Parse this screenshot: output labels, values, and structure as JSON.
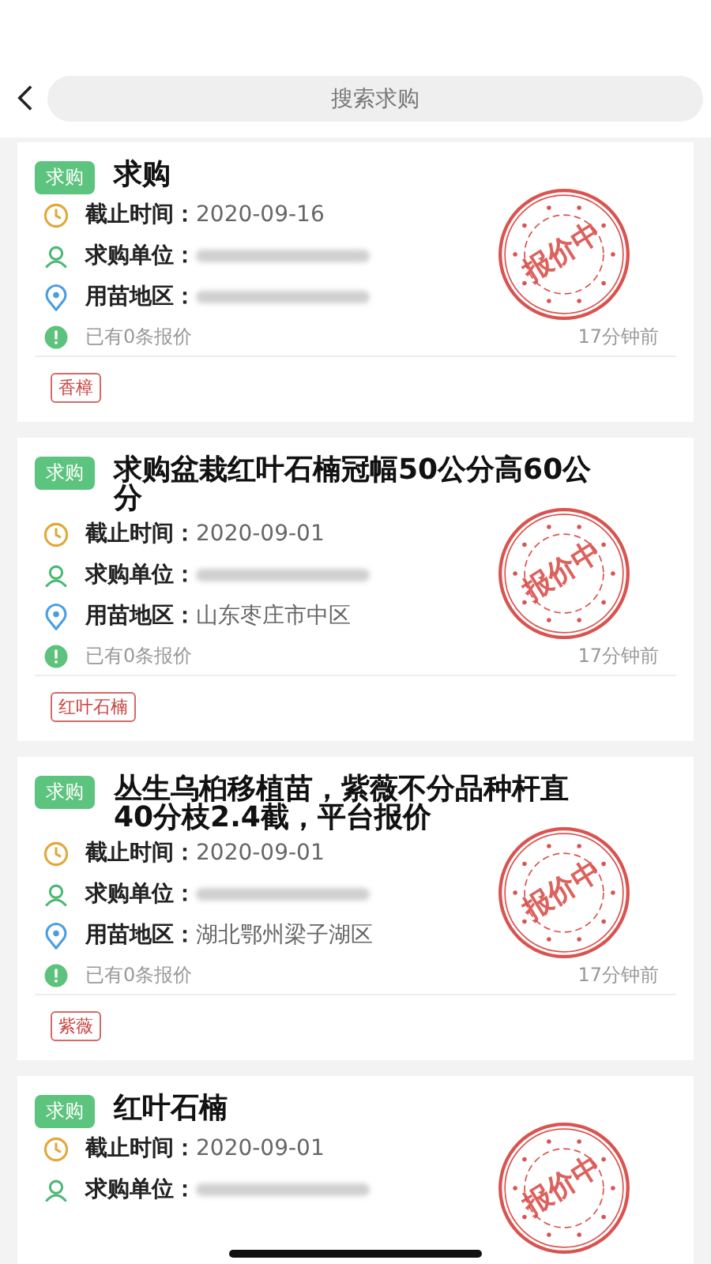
{
  "search": {
    "placeholder": "搜索求购"
  },
  "cards": [
    {
      "badge": "求购",
      "title": "求购",
      "stamp": "报价中",
      "fields": [
        {
          "kind": "deadline",
          "label": "截止时间：",
          "value": "2020-09-16"
        },
        {
          "kind": "unit",
          "label": "求购单位：",
          "blurred": true
        },
        {
          "kind": "area",
          "label": "用苗地区：",
          "blurred": true
        }
      ],
      "quotes": "已有0条报价",
      "time": "17分钟前",
      "tags": [
        "香樟"
      ]
    },
    {
      "badge": "求购",
      "title": "求购盆栽红叶石楠冠幅50公分高60公分",
      "stamp": "报价中",
      "fields": [
        {
          "kind": "deadline",
          "label": "截止时间：",
          "value": "2020-09-01"
        },
        {
          "kind": "unit",
          "label": "求购单位：",
          "blurred": true
        },
        {
          "kind": "area",
          "label": "用苗地区：",
          "value": "山东枣庄市中区"
        }
      ],
      "quotes": "已有0条报价",
      "time": "17分钟前",
      "tags": [
        "红叶石楠"
      ]
    },
    {
      "badge": "求购",
      "title": "丛生乌桕移植苗，紫薇不分品种杆直40分枝2.4截，平台报价",
      "stamp": "报价中",
      "fields": [
        {
          "kind": "deadline",
          "label": "截止时间：",
          "value": "2020-09-01"
        },
        {
          "kind": "unit",
          "label": "求购单位：",
          "blurred": true
        },
        {
          "kind": "area",
          "label": "用苗地区：",
          "value": "湖北鄂州梁子湖区"
        }
      ],
      "quotes": "已有0条报价",
      "time": "17分钟前",
      "tags": [
        "紫薇"
      ]
    },
    {
      "badge": "求购",
      "title": "红叶石楠",
      "stamp": "报价中",
      "fields": [
        {
          "kind": "deadline",
          "label": "截止时间：",
          "value": "2020-09-01"
        },
        {
          "kind": "unit",
          "label": "求购单位：",
          "blurred": true
        }
      ]
    }
  ]
}
